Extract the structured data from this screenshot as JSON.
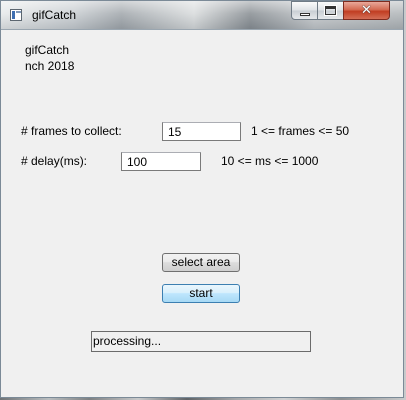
{
  "window": {
    "title": "gifCatch",
    "controls": {
      "minimize_icon": "minimize-icon",
      "maximize_icon": "maximize-icon",
      "close_icon": "close-icon",
      "close_glyph": "✕"
    }
  },
  "header": {
    "app_name": "gifCatch",
    "credit": "nch 2018"
  },
  "form": {
    "frames": {
      "label": "# frames to collect:",
      "value": "15",
      "range": "1 <= frames <= 50"
    },
    "delay": {
      "label": "# delay(ms):",
      "value": "100",
      "range": "10 <= ms <= 1000"
    }
  },
  "actions": {
    "select_area_label": "select area",
    "start_label": "start"
  },
  "status": {
    "text": "processing..."
  },
  "colors": {
    "close_button": "#c13d22",
    "default_button_border": "#3c7fb1",
    "window_background": "#f0f0f0"
  }
}
